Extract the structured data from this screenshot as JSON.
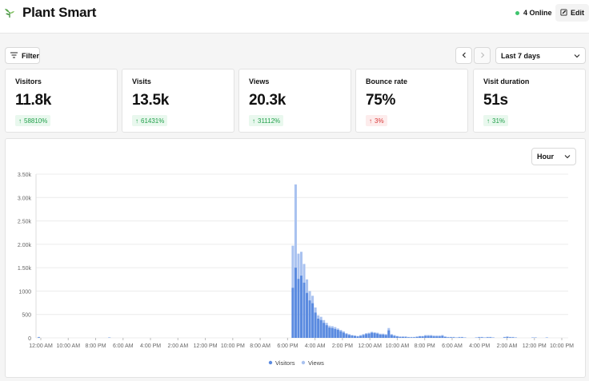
{
  "header": {
    "app_title": "Plant Smart",
    "online_text": "4 Online",
    "edit_label": "Edit"
  },
  "toolbar": {
    "filter_label": "Filter",
    "date_range": "Last 7 days"
  },
  "metrics": [
    {
      "label": "Visitors",
      "value": "11.8k",
      "change": "58810%",
      "direction": "up"
    },
    {
      "label": "Visits",
      "value": "13.5k",
      "change": "61431%",
      "direction": "up"
    },
    {
      "label": "Views",
      "value": "20.3k",
      "change": "31112%",
      "direction": "up"
    },
    {
      "label": "Bounce rate",
      "value": "75%",
      "change": "3%",
      "direction": "up-bad"
    },
    {
      "label": "Visit duration",
      "value": "51s",
      "change": "31%",
      "direction": "up"
    }
  ],
  "chart_controls": {
    "unit": "Hour"
  },
  "colors": {
    "visitors": "#5b8be0",
    "views": "#a9c2f0",
    "positive": "#22a04b",
    "negative": "#d93838",
    "online_dot": "#3ec46d"
  },
  "chart_data": {
    "type": "bar",
    "ylabel": "",
    "xlabel": "",
    "ylim": [
      0,
      3500
    ],
    "y_ticks": [
      0,
      500,
      1000,
      1500,
      2000,
      2500,
      3000,
      3500
    ],
    "y_tick_labels": [
      "0",
      "500",
      "1000",
      "1.50k",
      "2.00k",
      "2.50k",
      "3.00k",
      "3.50k"
    ],
    "x_tick_labels": [
      "12:00 AM",
      "10:00 AM",
      "8:00 PM",
      "6:00 AM",
      "4:00 PM",
      "2:00 AM",
      "12:00 PM",
      "10:00 PM",
      "8:00 AM",
      "6:00 PM",
      "4:00 AM",
      "2:00 PM",
      "12:00 AM",
      "10:00 AM",
      "8:00 PM",
      "6:00 AM",
      "4:00 PM",
      "2:00 AM",
      "12:00 PM",
      "10:00 PM"
    ],
    "legend": [
      "Visitors",
      "Views"
    ],
    "legend_position": "bottom-center",
    "grid": true,
    "bar_count": 188,
    "series": [
      {
        "name": "Visitors",
        "points": [
          [
            0,
            10
          ],
          [
            25,
            5
          ],
          [
            90,
            1070
          ],
          [
            91,
            1500
          ],
          [
            92,
            1260
          ],
          [
            93,
            1330
          ],
          [
            94,
            1180
          ],
          [
            95,
            960
          ],
          [
            96,
            800
          ],
          [
            97,
            740
          ],
          [
            98,
            540
          ],
          [
            99,
            410
          ],
          [
            100,
            380
          ],
          [
            101,
            320
          ],
          [
            102,
            270
          ],
          [
            103,
            220
          ],
          [
            104,
            210
          ],
          [
            105,
            190
          ],
          [
            106,
            170
          ],
          [
            107,
            140
          ],
          [
            108,
            110
          ],
          [
            109,
            80
          ],
          [
            110,
            60
          ],
          [
            111,
            50
          ],
          [
            112,
            40
          ],
          [
            113,
            30
          ],
          [
            114,
            40
          ],
          [
            115,
            60
          ],
          [
            116,
            80
          ],
          [
            117,
            90
          ],
          [
            118,
            110
          ],
          [
            119,
            100
          ],
          [
            120,
            90
          ],
          [
            121,
            70
          ],
          [
            122,
            70
          ],
          [
            123,
            60
          ],
          [
            124,
            160
          ],
          [
            125,
            60
          ],
          [
            126,
            40
          ],
          [
            127,
            30
          ],
          [
            128,
            20
          ],
          [
            129,
            20
          ],
          [
            130,
            20
          ],
          [
            131,
            10
          ],
          [
            132,
            10
          ],
          [
            133,
            10
          ],
          [
            134,
            20
          ],
          [
            135,
            30
          ],
          [
            136,
            30
          ],
          [
            137,
            40
          ],
          [
            138,
            40
          ],
          [
            139,
            40
          ],
          [
            140,
            30
          ],
          [
            141,
            30
          ],
          [
            142,
            30
          ],
          [
            143,
            40
          ],
          [
            144,
            20
          ],
          [
            145,
            10
          ],
          [
            146,
            10
          ],
          [
            147,
            10
          ],
          [
            148,
            5
          ],
          [
            149,
            10
          ],
          [
            150,
            10
          ],
          [
            151,
            5
          ],
          [
            155,
            5
          ],
          [
            156,
            10
          ],
          [
            157,
            10
          ],
          [
            158,
            5
          ],
          [
            159,
            10
          ],
          [
            160,
            10
          ],
          [
            161,
            5
          ],
          [
            165,
            10
          ],
          [
            166,
            20
          ],
          [
            167,
            10
          ],
          [
            168,
            10
          ],
          [
            169,
            5
          ],
          [
            175,
            5
          ],
          [
            176,
            5
          ],
          [
            180,
            5
          ]
        ]
      },
      {
        "name": "Views",
        "points": [
          [
            0,
            20
          ],
          [
            25,
            10
          ],
          [
            90,
            1970
          ],
          [
            91,
            3280
          ],
          [
            92,
            1800
          ],
          [
            93,
            1840
          ],
          [
            94,
            1580
          ],
          [
            95,
            1250
          ],
          [
            96,
            1000
          ],
          [
            97,
            900
          ],
          [
            98,
            650
          ],
          [
            99,
            480
          ],
          [
            100,
            450
          ],
          [
            101,
            380
          ],
          [
            102,
            320
          ],
          [
            103,
            260
          ],
          [
            104,
            250
          ],
          [
            105,
            230
          ],
          [
            106,
            200
          ],
          [
            107,
            170
          ],
          [
            108,
            140
          ],
          [
            109,
            100
          ],
          [
            110,
            80
          ],
          [
            111,
            60
          ],
          [
            112,
            50
          ],
          [
            113,
            40
          ],
          [
            114,
            60
          ],
          [
            115,
            80
          ],
          [
            116,
            100
          ],
          [
            117,
            110
          ],
          [
            118,
            130
          ],
          [
            119,
            120
          ],
          [
            120,
            110
          ],
          [
            121,
            90
          ],
          [
            122,
            90
          ],
          [
            123,
            80
          ],
          [
            124,
            210
          ],
          [
            125,
            80
          ],
          [
            126,
            60
          ],
          [
            127,
            40
          ],
          [
            128,
            30
          ],
          [
            129,
            30
          ],
          [
            130,
            30
          ],
          [
            131,
            20
          ],
          [
            132,
            20
          ],
          [
            133,
            20
          ],
          [
            134,
            30
          ],
          [
            135,
            40
          ],
          [
            136,
            40
          ],
          [
            137,
            60
          ],
          [
            138,
            60
          ],
          [
            139,
            60
          ],
          [
            140,
            50
          ],
          [
            141,
            50
          ],
          [
            142,
            50
          ],
          [
            143,
            60
          ],
          [
            144,
            30
          ],
          [
            145,
            20
          ],
          [
            146,
            20
          ],
          [
            147,
            20
          ],
          [
            148,
            10
          ],
          [
            149,
            20
          ],
          [
            150,
            20
          ],
          [
            151,
            10
          ],
          [
            155,
            10
          ],
          [
            156,
            20
          ],
          [
            157,
            20
          ],
          [
            158,
            10
          ],
          [
            159,
            20
          ],
          [
            160,
            20
          ],
          [
            161,
            10
          ],
          [
            165,
            20
          ],
          [
            166,
            30
          ],
          [
            167,
            20
          ],
          [
            168,
            20
          ],
          [
            169,
            10
          ],
          [
            175,
            10
          ],
          [
            176,
            10
          ],
          [
            180,
            10
          ]
        ]
      }
    ]
  }
}
